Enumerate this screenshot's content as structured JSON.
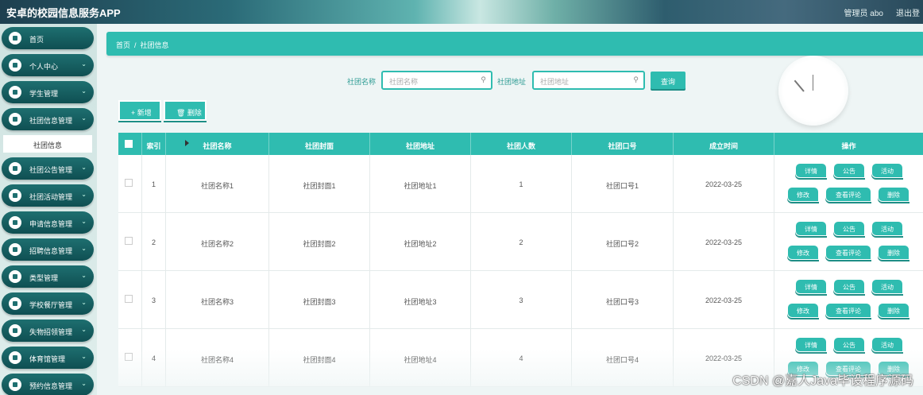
{
  "app": {
    "title": "安卓的校园信息服务APP",
    "user": "管理员 abo",
    "logout": "退出登"
  },
  "sidebar": {
    "items": [
      {
        "label": "首页",
        "icon": "home-icon",
        "chevron": false
      },
      {
        "label": "个人中心",
        "icon": "user-icon",
        "chevron": true
      },
      {
        "label": "学生管理",
        "icon": "grid-icon",
        "chevron": true
      },
      {
        "label": "社团信息管理",
        "icon": "list-icon",
        "chevron": true
      },
      {
        "label": "社团公告管理",
        "icon": "grid-icon",
        "chevron": true
      },
      {
        "label": "社团活动管理",
        "icon": "list-icon",
        "chevron": true
      },
      {
        "label": "申请信息管理",
        "icon": "send-icon",
        "chevron": true
      },
      {
        "label": "招聘信息管理",
        "icon": "briefcase-icon",
        "chevron": true
      },
      {
        "label": "类型管理",
        "icon": "book-icon",
        "chevron": true
      },
      {
        "label": "学校餐厅管理",
        "icon": "grid-icon",
        "chevron": true
      },
      {
        "label": "失物招领管理",
        "icon": "list-icon",
        "chevron": true
      },
      {
        "label": "体育馆管理",
        "icon": "user-icon",
        "chevron": true
      },
      {
        "label": "预约信息管理",
        "icon": "grid-icon",
        "chevron": true
      }
    ],
    "active_sub": "社团信息"
  },
  "breadcrumb": {
    "home": "首页",
    "sep": "/",
    "current": "社团信息"
  },
  "search": {
    "name_label": "社团名称",
    "name_placeholder": "社团名称",
    "addr_label": "社团地址",
    "addr_placeholder": "社团地址",
    "query_button": "查询"
  },
  "toolbar": {
    "add_label": "+ 新增",
    "delete_label": "🗑 删除"
  },
  "table": {
    "headers": [
      "索引",
      "社团名称",
      "社团封面",
      "社团地址",
      "社团人数",
      "社团口号",
      "成立时间",
      "操作"
    ],
    "rows": [
      {
        "index": "1",
        "name": "社团名称1",
        "cover": "社团封面1",
        "address": "社团地址1",
        "count": "1",
        "slogan": "社团口号1",
        "date": "2022-03-25"
      },
      {
        "index": "2",
        "name": "社团名称2",
        "cover": "社团封面2",
        "address": "社团地址2",
        "count": "2",
        "slogan": "社团口号2",
        "date": "2022-03-25"
      },
      {
        "index": "3",
        "name": "社团名称3",
        "cover": "社团封面3",
        "address": "社团地址3",
        "count": "3",
        "slogan": "社团口号3",
        "date": "2022-03-25"
      },
      {
        "index": "4",
        "name": "社团名称4",
        "cover": "社团封面4",
        "address": "社团地址4",
        "count": "4",
        "slogan": "社团口号4",
        "date": "2022-03-25"
      }
    ],
    "actions": {
      "detail": "详情",
      "notice": "公告",
      "activity": "活动",
      "edit": "修改",
      "comments": "查看评论",
      "delete": "删除"
    }
  },
  "watermark": "CSDN @嘉人Java毕设程序源码",
  "colors": {
    "accent": "#2fbcb0",
    "sidebar_item": "#1e6f70"
  }
}
